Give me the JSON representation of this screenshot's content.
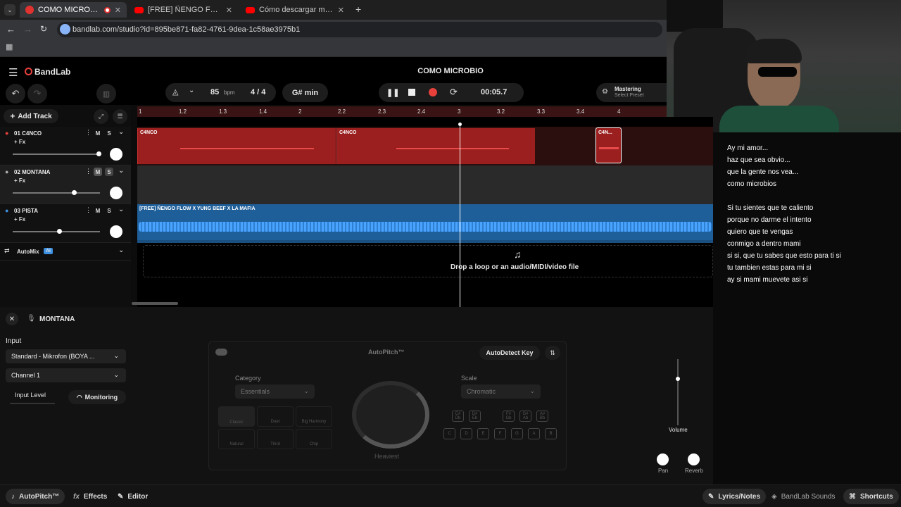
{
  "browser": {
    "tabs": [
      {
        "title": "COMO MICROBIO - Studio",
        "active": true
      },
      {
        "title": "[FREE] ÑENGO FLOW X YUNG B",
        "active": false
      },
      {
        "title": "Cómo descargar mensajes de v",
        "active": false
      }
    ],
    "new_tab": "+",
    "url": "bandlab.com/studio?id=895be871-fa82-4761-9dea-1c58ae3975b1"
  },
  "app": {
    "brand": "BandLab",
    "project_title": "COMO MICROBIO",
    "mastering": {
      "title": "Mastering",
      "subtitle": "Select Preset"
    }
  },
  "transport": {
    "bpm_value": "85",
    "bpm_unit": "bpm",
    "time_sig": "4 / 4",
    "key": "G# min",
    "time": "00:05.7"
  },
  "ruler": {
    "ticks": [
      "1",
      "1.2",
      "1.3",
      "1.4",
      "2",
      "2.2",
      "2.3",
      "2.4",
      "3",
      "3.2",
      "3.3",
      "3.4",
      "4"
    ]
  },
  "tracks": [
    {
      "name": "01  C4NCO",
      "fx": "+ Fx",
      "mute": "M",
      "solo": "S",
      "vol": 0.98,
      "color": "#e8413c"
    },
    {
      "name": "02  MONTANA",
      "fx": "+ Fx",
      "mute": "M",
      "solo": "S",
      "vol": 0.7,
      "color": "#aaaaaa"
    },
    {
      "name": "03  PISTA",
      "fx": "+ Fx",
      "mute": "M",
      "solo": "S",
      "vol": 0.53,
      "color": "#3d8fe0"
    }
  ],
  "add_track": "Add Track",
  "automix": {
    "label": "AutoMix",
    "badge": "AI"
  },
  "clips": {
    "c1": "C4NCO",
    "c2": "C4NCO",
    "c3": "C4N...",
    "pista": "[FREE] ÑENGO FLOW X YUNG BEEF X LA MAFIA"
  },
  "dropzone": "Drop a loop or an audio/MIDI/video file",
  "lyrics": {
    "lines": [
      "Ay mi amor...",
      "haz  que sea obvio...",
      "que la gente nos vea...",
      "como microbios",
      "",
      "Si tu sientes que te caliento",
      "porque no darme el intento",
      "quiero que te vengas",
      "conmigo a dentro mami",
      "si si, que tu sabes que esto para ti si",
      "tu tambien estas para mi si",
      "ay si mami muevete asi si"
    ]
  },
  "editor": {
    "track_name": "MONTANA",
    "input_label": "Input",
    "input_device": "Standard - Mikrofon (BOYA ...",
    "channel": "Channel 1",
    "input_level": "Input Level",
    "monitoring": "Monitoring",
    "autopitch_title": "AutoPitch™",
    "autodetect": "AutoDetect Key",
    "category_label": "Category",
    "category_value": "Essentials",
    "scale_label": "Scale",
    "scale_value": "Chromatic",
    "categories": [
      "Classic",
      "Duet",
      "Big Harmony",
      "Natural",
      "Third",
      "Chip"
    ],
    "sharp_keys": [
      "C# Db",
      "D# Eb",
      "F# Gb",
      "G# Ab",
      "A# Bb"
    ],
    "natural_keys": [
      "C",
      "D",
      "E",
      "F",
      "G",
      "A",
      "B"
    ],
    "dial_label": "Heaviest",
    "volume_label": "Volume",
    "pan_label": "Pan",
    "reverb_label": "Reverb"
  },
  "footer": {
    "autopitch": "AutoPitch™",
    "effects": "Effects",
    "editor": "Editor",
    "lyrics_notes": "Lyrics/Notes",
    "sounds": "BandLab Sounds",
    "shortcuts": "Shortcuts"
  },
  "colors": {
    "accent": "#e8413c",
    "blue": "#3d8fe0",
    "bg": "#000000"
  }
}
